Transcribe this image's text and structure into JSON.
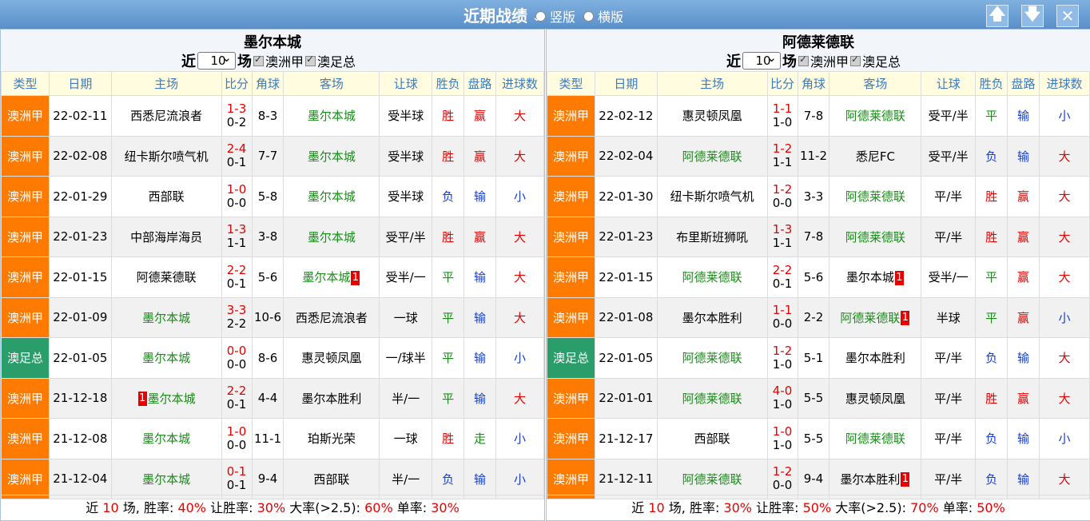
{
  "header": {
    "title": "近期战绩",
    "radio_vertical": "竖版",
    "radio_horizontal": "横版",
    "btn_up": "🡅",
    "btn_down": "🡇",
    "btn_close": "✕"
  },
  "columns": [
    "类型",
    "日期",
    "主场",
    "比分",
    "角球",
    "客场",
    "让球",
    "胜负",
    "盘路",
    "进球数"
  ],
  "left": {
    "team": "墨尔本城",
    "recent_prefix": "近",
    "recent_value": "10",
    "recent_suffix": "场",
    "filter1": "澳洲甲",
    "filter2": "澳足总",
    "rows": [
      {
        "type": "澳洲甲",
        "tc": "a",
        "date": "22-02-11",
        "home": "西悉尼流浪者",
        "hg": false,
        "ft": "1-3",
        "ht": "0-2",
        "corner": "8-3",
        "away": "墨尔本城",
        "ag": true,
        "hcp": "受半球",
        "wl": "胜",
        "wlc": "red",
        "pan": "赢",
        "panc": "red",
        "goal": "大",
        "goalc": "red"
      },
      {
        "type": "澳洲甲",
        "tc": "a",
        "date": "22-02-08",
        "home": "纽卡斯尔喷气机",
        "hg": false,
        "ft": "2-4",
        "ht": "0-1",
        "corner": "7-7",
        "away": "墨尔本城",
        "ag": true,
        "hcp": "受半球",
        "wl": "胜",
        "wlc": "red",
        "pan": "赢",
        "panc": "red",
        "goal": "大",
        "goalc": "red"
      },
      {
        "type": "澳洲甲",
        "tc": "a",
        "date": "22-01-29",
        "home": "西部联",
        "hg": false,
        "ft": "1-0",
        "ht": "0-0",
        "corner": "5-8",
        "away": "墨尔本城",
        "ag": true,
        "hcp": "受半球",
        "wl": "负",
        "wlc": "blue",
        "pan": "输",
        "panc": "blue",
        "goal": "小",
        "goalc": "blue"
      },
      {
        "type": "澳洲甲",
        "tc": "a",
        "date": "22-01-23",
        "home": "中部海岸海员",
        "hg": false,
        "ft": "1-3",
        "ht": "1-1",
        "corner": "3-8",
        "away": "墨尔本城",
        "ag": true,
        "hcp": "受平/半",
        "wl": "胜",
        "wlc": "red",
        "pan": "赢",
        "panc": "red",
        "goal": "大",
        "goalc": "red"
      },
      {
        "type": "澳洲甲",
        "tc": "a",
        "date": "22-01-15",
        "home": "阿德莱德联",
        "hg": false,
        "ft": "2-2",
        "ht": "0-1",
        "corner": "5-6",
        "away": "墨尔本城",
        "ag": true,
        "away_rc": "1",
        "hcp": "受半/一",
        "wl": "平",
        "wlc": "green",
        "pan": "输",
        "panc": "blue",
        "goal": "大",
        "goalc": "red"
      },
      {
        "type": "澳洲甲",
        "tc": "a",
        "date": "22-01-09",
        "home": "墨尔本城",
        "hg": true,
        "ft": "3-3",
        "ht": "2-2",
        "corner": "10-6",
        "away": "西悉尼流浪者",
        "ag": false,
        "hcp": "一球",
        "wl": "平",
        "wlc": "green",
        "pan": "输",
        "panc": "blue",
        "goal": "大",
        "goalc": "red"
      },
      {
        "type": "澳足总",
        "tc": "b",
        "date": "22-01-05",
        "home": "墨尔本城",
        "hg": true,
        "ft": "0-0",
        "ht": "0-0",
        "corner": "8-6",
        "away": "惠灵顿凤凰",
        "ag": false,
        "hcp": "一/球半",
        "wl": "平",
        "wlc": "green",
        "pan": "输",
        "panc": "blue",
        "goal": "小",
        "goalc": "blue"
      },
      {
        "type": "澳洲甲",
        "tc": "a",
        "date": "21-12-18",
        "home": "墨尔本城",
        "hg": true,
        "home_rc_pre": "1",
        "ft": "2-2",
        "ht": "0-1",
        "corner": "4-4",
        "away": "墨尔本胜利",
        "ag": false,
        "hcp": "半/一",
        "wl": "平",
        "wlc": "green",
        "pan": "输",
        "panc": "blue",
        "goal": "大",
        "goalc": "red"
      },
      {
        "type": "澳洲甲",
        "tc": "a",
        "date": "21-12-08",
        "home": "墨尔本城",
        "hg": true,
        "ft": "1-0",
        "ht": "0-0",
        "corner": "11-1",
        "away": "珀斯光荣",
        "ag": false,
        "hcp": "一球",
        "wl": "胜",
        "wlc": "red",
        "pan": "走",
        "panc": "green",
        "goal": "小",
        "goalc": "blue"
      },
      {
        "type": "澳洲甲",
        "tc": "a",
        "date": "21-12-04",
        "home": "墨尔本城",
        "hg": true,
        "ft": "0-1",
        "ht": "0-1",
        "corner": "9-4",
        "away": "西部联",
        "ag": false,
        "hcp": "半/一",
        "wl": "负",
        "wlc": "blue",
        "pan": "输",
        "panc": "blue",
        "goal": "小",
        "goalc": "blue"
      }
    ],
    "summary": {
      "p1": "近",
      "n": "10",
      "p2": "场, 胜率:",
      "win": "40%",
      "p3": "让胜率:",
      "hwin": "30%",
      "p4": "大率(>2.5):",
      "big": "60%",
      "p5": "单率:",
      "odd": "30%"
    }
  },
  "right": {
    "team": "阿德莱德联",
    "recent_prefix": "近",
    "recent_value": "10",
    "recent_suffix": "场",
    "filter1": "澳洲甲",
    "filter2": "澳足总",
    "rows": [
      {
        "type": "澳洲甲",
        "tc": "a",
        "date": "22-02-12",
        "home": "惠灵顿凤凰",
        "hg": false,
        "ft": "1-1",
        "ht": "1-0",
        "corner": "7-8",
        "away": "阿德莱德联",
        "ag": true,
        "hcp": "受平/半",
        "wl": "平",
        "wlc": "green",
        "pan": "输",
        "panc": "blue",
        "goal": "小",
        "goalc": "blue"
      },
      {
        "type": "澳洲甲",
        "tc": "a",
        "date": "22-02-04",
        "home": "阿德莱德联",
        "hg": true,
        "ft": "1-2",
        "ht": "1-1",
        "corner": "11-2",
        "away": "悉尼FC",
        "ag": false,
        "hcp": "受平/半",
        "wl": "负",
        "wlc": "blue",
        "pan": "输",
        "panc": "blue",
        "goal": "大",
        "goalc": "red"
      },
      {
        "type": "澳洲甲",
        "tc": "a",
        "date": "22-01-30",
        "home": "纽卡斯尔喷气机",
        "hg": false,
        "ft": "1-2",
        "ht": "0-0",
        "corner": "3-3",
        "away": "阿德莱德联",
        "ag": true,
        "hcp": "平/半",
        "wl": "胜",
        "wlc": "red",
        "pan": "赢",
        "panc": "red",
        "goal": "大",
        "goalc": "red"
      },
      {
        "type": "澳洲甲",
        "tc": "a",
        "date": "22-01-23",
        "home": "布里斯班狮吼",
        "hg": false,
        "ft": "1-3",
        "ht": "1-1",
        "corner": "7-8",
        "away": "阿德莱德联",
        "ag": true,
        "hcp": "平/半",
        "wl": "胜",
        "wlc": "red",
        "pan": "赢",
        "panc": "red",
        "goal": "大",
        "goalc": "red"
      },
      {
        "type": "澳洲甲",
        "tc": "a",
        "date": "22-01-15",
        "home": "阿德莱德联",
        "hg": true,
        "ft": "2-2",
        "ht": "0-1",
        "corner": "5-6",
        "away": "墨尔本城",
        "ag": false,
        "away_rc": "1",
        "hcp": "受半/一",
        "wl": "平",
        "wlc": "green",
        "pan": "赢",
        "panc": "red",
        "goal": "大",
        "goalc": "red"
      },
      {
        "type": "澳洲甲",
        "tc": "a",
        "date": "22-01-08",
        "home": "墨尔本胜利",
        "hg": false,
        "ft": "1-1",
        "ht": "0-0",
        "corner": "2-2",
        "away": "阿德莱德联",
        "ag": true,
        "away_rc": "1",
        "hcp": "半球",
        "wl": "平",
        "wlc": "green",
        "pan": "赢",
        "panc": "red",
        "goal": "小",
        "goalc": "blue"
      },
      {
        "type": "澳足总",
        "tc": "b",
        "date": "22-01-05",
        "home": "阿德莱德联",
        "hg": true,
        "ft": "1-2",
        "ht": "1-0",
        "corner": "5-1",
        "away": "墨尔本胜利",
        "ag": false,
        "hcp": "平/半",
        "wl": "负",
        "wlc": "blue",
        "pan": "输",
        "panc": "blue",
        "goal": "大",
        "goalc": "red"
      },
      {
        "type": "澳洲甲",
        "tc": "a",
        "date": "22-01-01",
        "home": "阿德莱德联",
        "hg": true,
        "ft": "4-0",
        "ht": "1-0",
        "corner": "5-5",
        "away": "惠灵顿凤凰",
        "ag": false,
        "hcp": "平/半",
        "wl": "胜",
        "wlc": "red",
        "pan": "赢",
        "panc": "red",
        "goal": "大",
        "goalc": "red"
      },
      {
        "type": "澳洲甲",
        "tc": "a",
        "date": "21-12-17",
        "home": "西部联",
        "hg": false,
        "ft": "1-0",
        "ht": "1-0",
        "corner": "5-5",
        "away": "阿德莱德联",
        "ag": true,
        "hcp": "平/半",
        "wl": "负",
        "wlc": "blue",
        "pan": "输",
        "panc": "blue",
        "goal": "小",
        "goalc": "blue"
      },
      {
        "type": "澳洲甲",
        "tc": "a",
        "date": "21-12-11",
        "home": "阿德莱德联",
        "hg": true,
        "ft": "1-2",
        "ht": "0-0",
        "corner": "9-4",
        "away": "墨尔本胜利",
        "ag": false,
        "away_rc": "1",
        "hcp": "平/半",
        "wl": "负",
        "wlc": "blue",
        "pan": "输",
        "panc": "blue",
        "goal": "大",
        "goalc": "red"
      }
    ],
    "summary": {
      "p1": "近",
      "n": "10",
      "p2": "场, 胜率:",
      "win": "30%",
      "p3": "让胜率:",
      "hwin": "50%",
      "p4": "大率(>2.5):",
      "big": "70%",
      "p5": "单率:",
      "odd": "50%"
    }
  }
}
